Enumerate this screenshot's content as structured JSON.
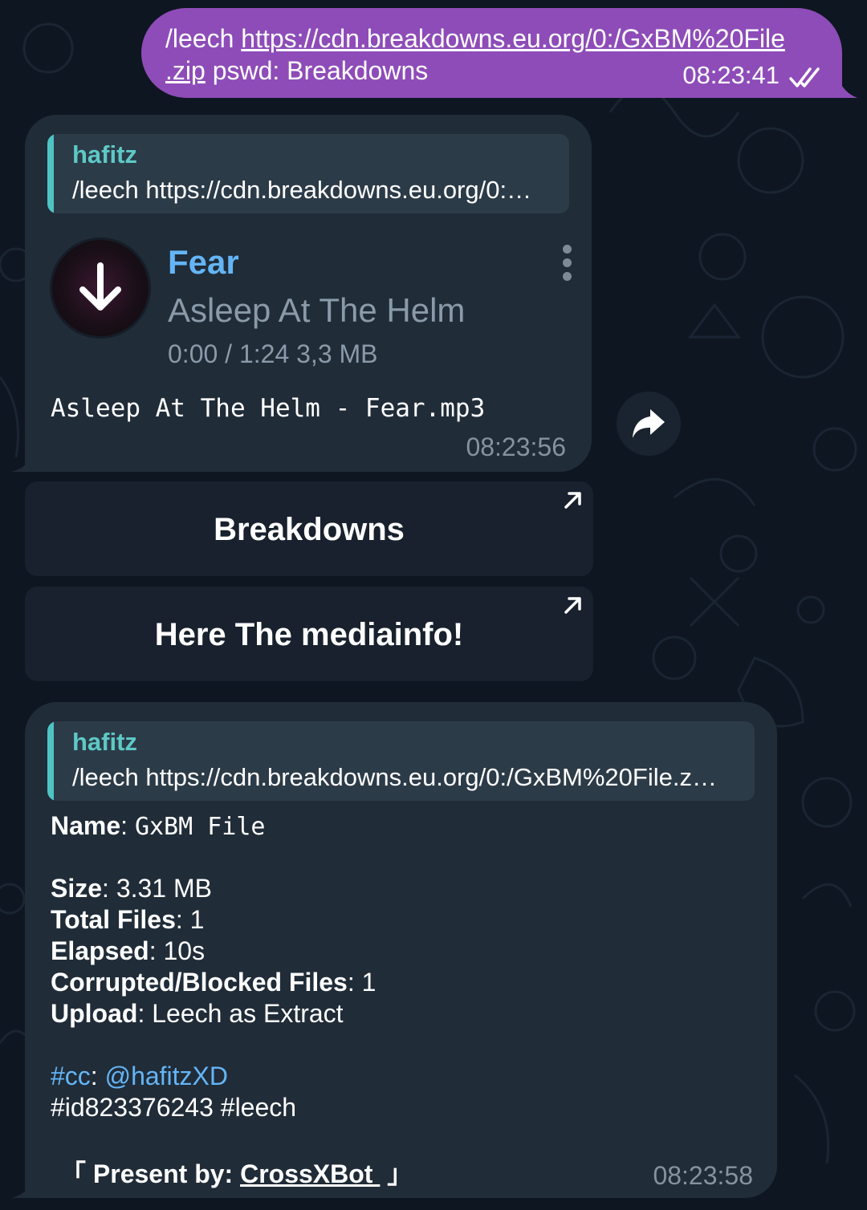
{
  "outgoing": {
    "command": "/leech ",
    "link_line1": "https://cdn.breakdowns.eu.org/0:/GxBM%20File",
    "link_line2": ".zip",
    "rest": " pswd: Breakdowns",
    "time": "08:23:41",
    "status_icon": "double-check-icon"
  },
  "audio_message": {
    "reply": {
      "name": "hafitz",
      "text": "/leech https://cdn.breakdowns.eu.org/0:…"
    },
    "title": "Fear",
    "artist": "Asleep At The Helm",
    "meta": "0:00 / 1:24 3,3 MB",
    "filename": "Asleep At The Helm - Fear.mp3",
    "time": "08:23:56",
    "download_icon": "download-icon",
    "menu_icon": "more-vertical-icon"
  },
  "share_icon": "share-icon",
  "inline_buttons": [
    {
      "label": "Breakdowns",
      "icon": "external-arrow-icon"
    },
    {
      "label": "Here The mediainfo!",
      "icon": "external-arrow-icon"
    }
  ],
  "info_message": {
    "reply": {
      "name": "hafitz",
      "text": "/leech https://cdn.breakdowns.eu.org/0:/GxBM%20File.z…"
    },
    "name_label": "Name",
    "name_value": "GxBM File",
    "size_label": "Size",
    "size_value": "3.31 MB",
    "total_label": "Total Files",
    "total_value": "1",
    "elapsed_label": "Elapsed",
    "elapsed_value": "10s",
    "corrupted_label": "Corrupted/Blocked Files",
    "corrupted_value": "1",
    "upload_label": "Upload",
    "upload_value": "Leech as Extract",
    "cc_tag": "#cc",
    "cc_user": "@hafitzXD",
    "tags": "#id823376243 #leech",
    "present_open": "「 ",
    "present_label": "Present by: ",
    "present_link": "CrossXBot ",
    "present_close": " 」",
    "time": "08:23:58"
  },
  "colors": {
    "background": "#0e1621",
    "outgoing_bubble": "#8e4cb8",
    "incoming_bubble": "#202c38",
    "accent_teal": "#5ec9c6",
    "link_blue": "#64b5f6"
  }
}
